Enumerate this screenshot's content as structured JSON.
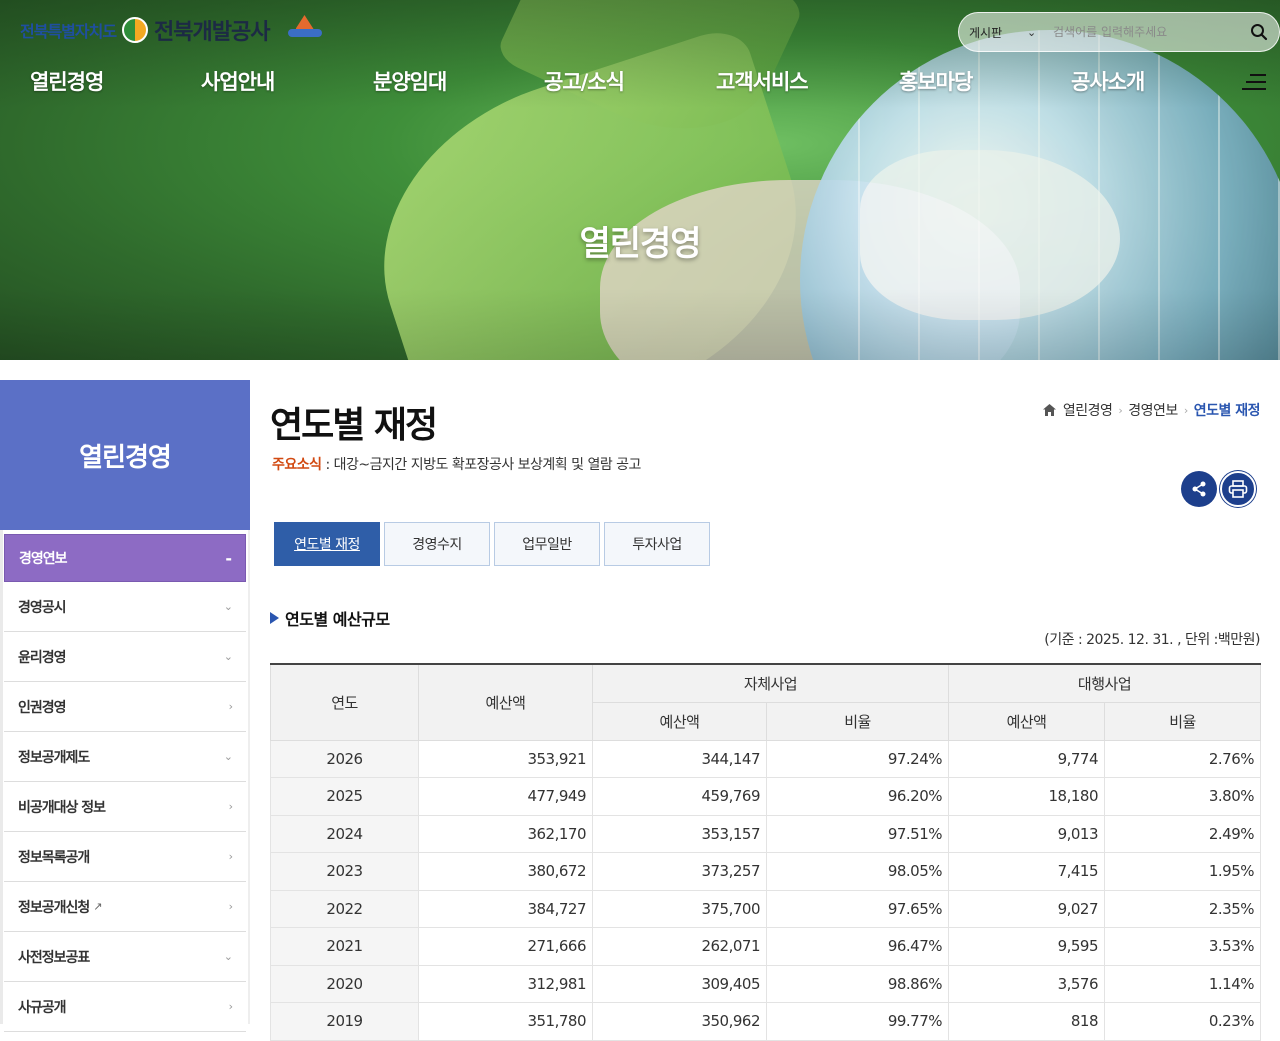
{
  "header": {
    "province_logo": "전북특별자치도",
    "corp_logo": "전북개발공사",
    "search": {
      "category": "게시판",
      "placeholder": "검색어를 입력해주세요"
    },
    "gnb": [
      "열린경영",
      "사업안내",
      "분양임대",
      "공고/소식",
      "고객서비스",
      "홍보마당",
      "공사소개"
    ],
    "hero_title": "열린경영"
  },
  "sidebar": {
    "title": "열린경영",
    "items": [
      {
        "label": "경영연보",
        "state": "-",
        "active": true
      },
      {
        "label": "경영공시",
        "state": "v"
      },
      {
        "label": "윤리경영",
        "state": "v"
      },
      {
        "label": "인권경영",
        "state": ">"
      },
      {
        "label": "정보공개제도",
        "state": "v"
      },
      {
        "label": "비공개대상 정보",
        "state": ">"
      },
      {
        "label": "정보목록공개",
        "state": ">"
      },
      {
        "label": "정보공개신청",
        "state": ">",
        "external": true
      },
      {
        "label": "사전정보공표",
        "state": "v"
      },
      {
        "label": "사규공개",
        "state": ">"
      }
    ]
  },
  "main": {
    "title": "연도별 재정",
    "news_label": "주요소식",
    "news_text": " : 대강~금지간 지방도 확포장공사 보상계획 및 열람 공고",
    "breadcrumb": [
      "열린경영",
      "경영연보",
      "연도별 재정"
    ],
    "tabs": [
      "연도별 재정",
      "경영수지",
      "업무일반",
      "투자사업"
    ],
    "section_title": "연도별 예산규모",
    "unit_note": "(기준 : 2025. 12. 31. , 단위 :백만원)",
    "table": {
      "h_year": "연도",
      "h_budget": "예산액",
      "h_own": "자체사업",
      "h_agency": "대행사업",
      "h_sub_budget": "예산액",
      "h_sub_ratio": "비율",
      "rows": [
        [
          "2026",
          "353,921",
          "344,147",
          "97.24%",
          "9,774",
          "2.76%"
        ],
        [
          "2025",
          "477,949",
          "459,769",
          "96.20%",
          "18,180",
          "3.80%"
        ],
        [
          "2024",
          "362,170",
          "353,157",
          "97.51%",
          "9,013",
          "2.49%"
        ],
        [
          "2023",
          "380,672",
          "373,257",
          "98.05%",
          "7,415",
          "1.95%"
        ],
        [
          "2022",
          "384,727",
          "375,700",
          "97.65%",
          "9,027",
          "2.35%"
        ],
        [
          "2021",
          "271,666",
          "262,071",
          "96.47%",
          "9,595",
          "3.53%"
        ],
        [
          "2020",
          "312,981",
          "309,405",
          "98.86%",
          "3,576",
          "1.14%"
        ],
        [
          "2019",
          "351,780",
          "350,962",
          "99.77%",
          "818",
          "0.23%"
        ]
      ]
    }
  },
  "colors": {
    "sidebar_head": "#5b70c6",
    "sidebar_active": "#8d6bc4",
    "tab_active": "#2f5ea8",
    "accent_label": "#d24a12"
  }
}
